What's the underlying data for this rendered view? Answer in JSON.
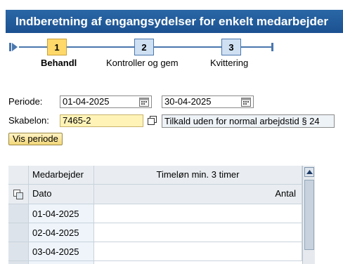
{
  "header": {
    "title": "Indberetning af engangsydelser for enkelt medarbejder"
  },
  "roadmap": {
    "steps": [
      {
        "number": "1",
        "label": "Behandl",
        "active": true
      },
      {
        "number": "2",
        "label": "Kontroller og gem",
        "active": false
      },
      {
        "number": "3",
        "label": "Kvittering",
        "active": false
      }
    ]
  },
  "form": {
    "periode_label": "Periode:",
    "periode_from": "01-04-2025",
    "periode_to": "30-04-2025",
    "skabelon_label": "Skabelon:",
    "skabelon_value": "7465-2",
    "skabelon_description": "Tilkald uden for normal arbejdstid § 24",
    "vis_periode_button": "Vis periode"
  },
  "table": {
    "header_row1": {
      "col1": "Medarbejder",
      "col2": "Timeløn min. 3 timer"
    },
    "header_row2": {
      "col1": "Dato",
      "col2": "Antal"
    },
    "rows": [
      {
        "date": "01-04-2025",
        "antal": ""
      },
      {
        "date": "02-04-2025",
        "antal": ""
      },
      {
        "date": "03-04-2025",
        "antal": ""
      }
    ]
  },
  "colors": {
    "title_bg": "#1f5898",
    "active_step": "#ffd86a",
    "step_box": "#cfe0f3",
    "input_highlight": "#fff3b8"
  }
}
